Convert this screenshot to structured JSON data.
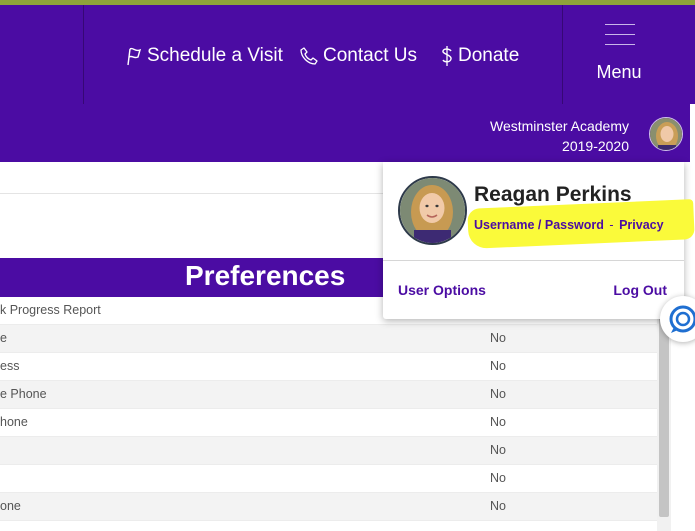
{
  "nav": {
    "schedule_label": "Schedule a Visit",
    "contact_label": "Contact Us",
    "donate_label": "Donate",
    "menu_label": "Menu"
  },
  "school": {
    "name": "Westminster Academy",
    "year": "2019-2020"
  },
  "preferences": {
    "title": "Preferences",
    "rows": [
      {
        "label": "k Progress Report",
        "value": ""
      },
      {
        "label": "e",
        "value": "No"
      },
      {
        "label": "ess",
        "value": "No"
      },
      {
        "label": "e Phone",
        "value": "No"
      },
      {
        "label": "hone",
        "value": "No"
      },
      {
        "label": "",
        "value": "No"
      },
      {
        "label": "",
        "value": "No"
      },
      {
        "label": "one",
        "value": "No"
      }
    ]
  },
  "user_menu": {
    "name": "Reagan Perkins",
    "username_password_label": "Username / Password",
    "separator": "-",
    "privacy_label": "Privacy",
    "user_options_label": "User Options",
    "logout_label": "Log Out"
  },
  "icons": {
    "schedule": "flag-icon",
    "contact": "phone-icon",
    "donate": "dollar-icon",
    "menu": "hamburger-icon",
    "chat": "chat-icon"
  },
  "colors": {
    "brand_purple": "#4b0ca3",
    "top_stripe": "#8fa33a",
    "highlight": "#fafa3a"
  }
}
